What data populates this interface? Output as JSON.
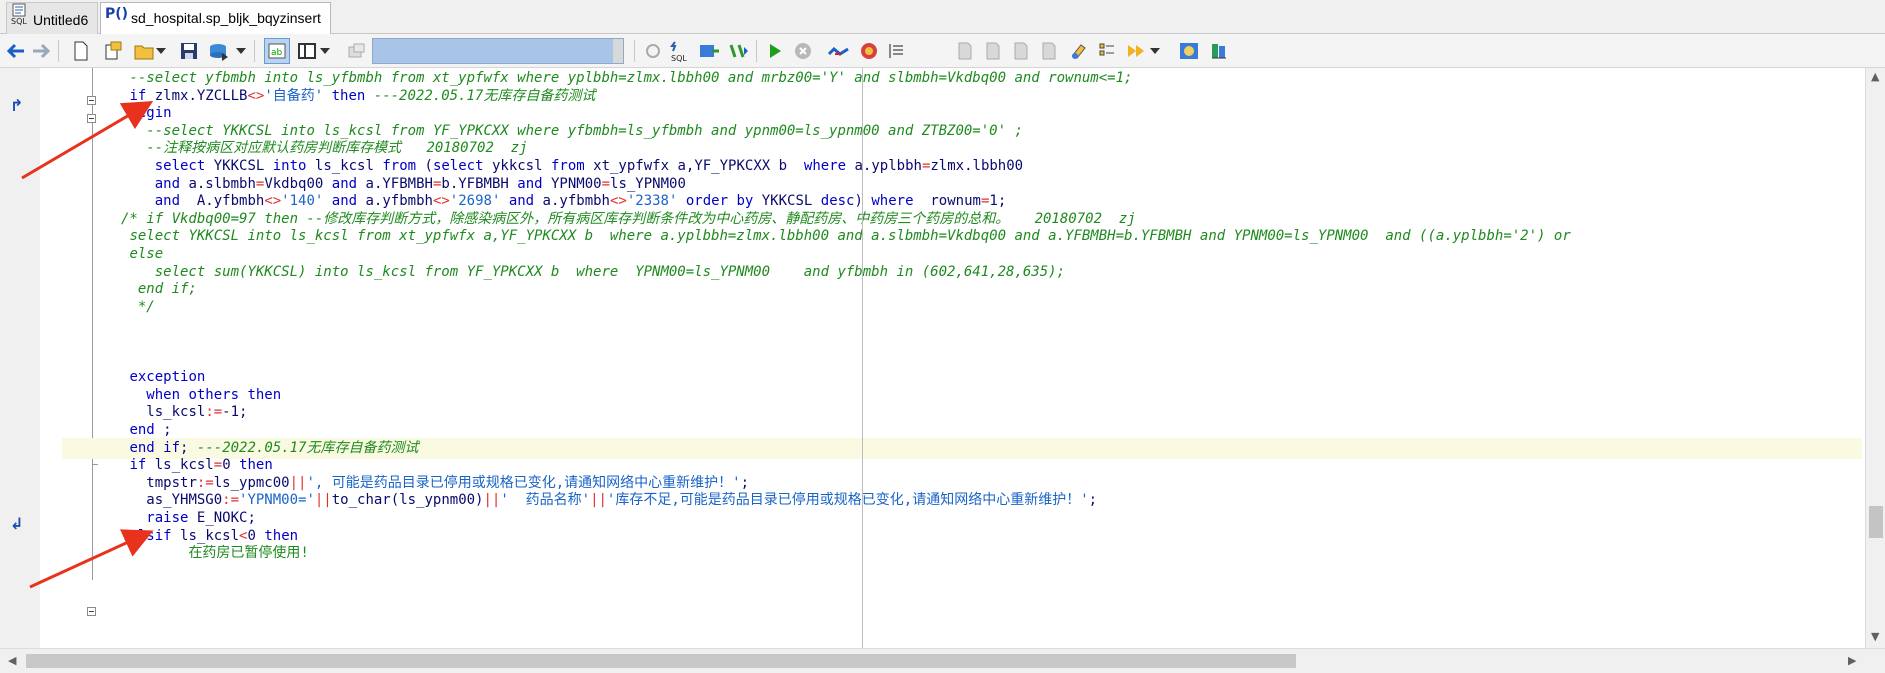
{
  "tabs": [
    {
      "icon": "sql-icon",
      "label": "Untitled6"
    },
    {
      "icon": "procedure-icon",
      "label": "sd_hospital.sp_bljk_bqyzinsert"
    }
  ],
  "toolbar": {
    "combo_value": ""
  },
  "code_lines": [
    {
      "text": "--select yfbmbh into ls_yfbmbh from xt_ypfwfx where yplbbh=zlmx.lbbh00 and mrbz00='Y' and slbmbh=Vkdbq00 and rownum<=1;",
      "style": "cmt",
      "indent": 8
    },
    {
      "text": "if zlmx.YZCLLB<>'自备药' then ---2022.05.17无库存自备药测试",
      "style": "mixed_if",
      "indent": 8
    },
    {
      "text": "begin",
      "style": "kw",
      "indent": 8
    },
    {
      "text": "--select YKKCSL into ls_kcsl from YF_YPKCXX where yfbmbh=ls_yfbmbh and ypnm00=ls_ypnm00 and ZTBZ00='0' ;",
      "style": "cmt",
      "indent": 10
    },
    {
      "text": "--注释按病区对应默认药房判断库存模式   20180702  zj",
      "style": "cmt",
      "indent": 10
    },
    {
      "text": "select YKKCSL into ls_kcsl from (select ykkcsl from xt_ypfwfx a,YF_YPKCXX b  where a.yplbbh=zlmx.lbbh00",
      "style": "sql1",
      "indent": 11
    },
    {
      "text": "and a.slbmbh=Vkdbq00 and a.YFBMBH=b.YFBMBH and YPNM00=ls_YPNM00",
      "style": "sql2",
      "indent": 11
    },
    {
      "text": "and  A.yfbmbh<>'140' and a.yfbmbh<>'2698' and a.yfbmbh<>'2338' order by YKKCSL desc) where  rownum=1;",
      "style": "sql3",
      "indent": 11
    },
    {
      "text": "/* if Vkdbq00=97 then --修改库存判断方式，除感染病区外，所有病区库存判断条件改为中心药房、静配药房、中药房三个药房的总和。   20180702  zj",
      "style": "cmt",
      "indent": 7
    },
    {
      "text": "select YKKCSL into ls_kcsl from xt_ypfwfx a,YF_YPKCXX b  where a.yplbbh=zlmx.lbbh00 and a.slbmbh=Vkdbq00 and a.YFBMBH=b.YFBMBH and YPNM00=ls_YPNM00  and ((a.yplbbh='2') or",
      "style": "cmt",
      "indent": 8
    },
    {
      "text": "else",
      "style": "cmt",
      "indent": 8
    },
    {
      "text": "select sum(YKKCSL) into ls_kcsl from YF_YPKCXX b  where  YPNM00=ls_YPNM00    and yfbmbh in (602,641,28,635);",
      "style": "cmt",
      "indent": 11
    },
    {
      "text": "end if;",
      "style": "cmt",
      "indent": 9
    },
    {
      "text": "*/",
      "style": "cmt",
      "indent": 9
    },
    {
      "text": "",
      "style": "cmt",
      "indent": 0
    },
    {
      "text": "",
      "style": "cmt",
      "indent": 0
    },
    {
      "text": "",
      "style": "cmt",
      "indent": 0
    },
    {
      "text": "exception",
      "style": "kw",
      "indent": 8
    },
    {
      "text": "when others then",
      "style": "kw",
      "indent": 10
    },
    {
      "text": "ls_kcsl:=-1;",
      "style": "assign",
      "indent": 10
    },
    {
      "text": "end ;",
      "style": "endsemi",
      "indent": 8
    },
    {
      "text": "end if; ---2022.05.17无库存自备药测试",
      "style": "endif",
      "indent": 8
    },
    {
      "text": "if ls_kcsl=0 then",
      "style": "ifzero",
      "indent": 8
    },
    {
      "text": "tmpstr:=ls_ypmc00||', 可能是药品目录已停用或规格已变化,请通知网络中心重新维护！';",
      "style": "tmpstr",
      "indent": 10
    },
    {
      "text": "as_YHMSG0:='YPNM00='||to_char(ls_ypnm00)||'  药品名称'||'库存不足,可能是药品目录已停用或规格已变化,请通知网络中心重新维护！';",
      "style": "yhmsg",
      "indent": 10
    },
    {
      "text": "raise E_NOKC;",
      "style": "raise",
      "indent": 10
    },
    {
      "text": "elsif ls_kcsl<0 then",
      "style": "elsif",
      "indent": 8
    },
    {
      "text": "在药房已暂停使用!",
      "style": "partial",
      "indent": 15
    }
  ]
}
